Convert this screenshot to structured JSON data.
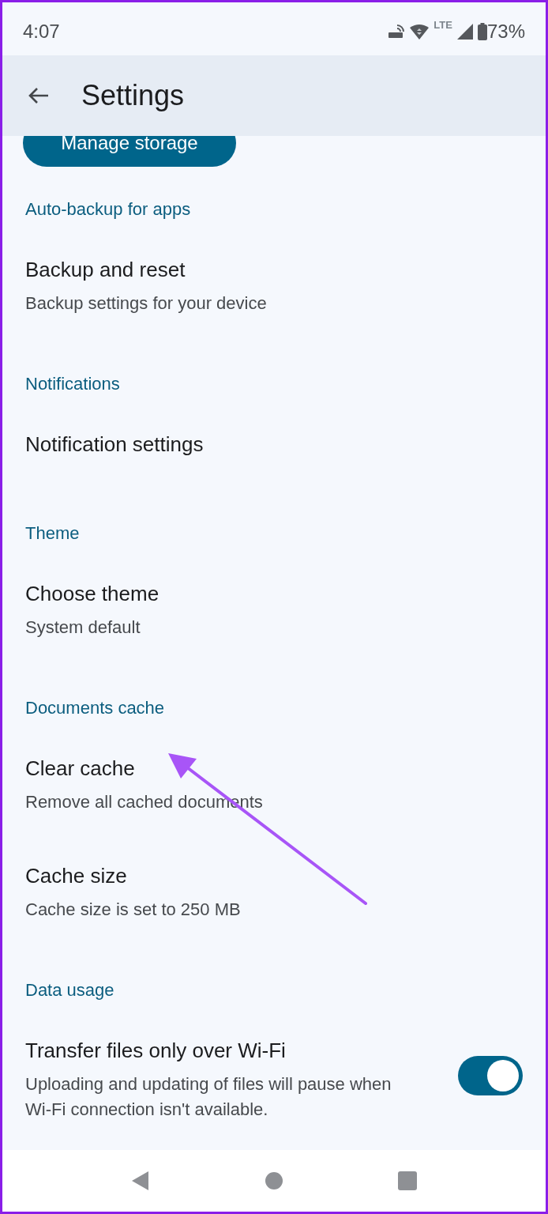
{
  "status_bar": {
    "time": "4:07",
    "network_label": "LTE",
    "battery": "73%"
  },
  "app_bar": {
    "title": "Settings"
  },
  "manage_storage_button": {
    "label": "Manage storage"
  },
  "sections": [
    {
      "header": "Auto-backup for apps",
      "items": [
        {
          "kind": "item",
          "title": "Backup and reset",
          "subtitle": "Backup settings for your device"
        }
      ]
    },
    {
      "header": "Notifications",
      "items": [
        {
          "kind": "item",
          "title": "Notification settings"
        }
      ]
    },
    {
      "header": "Theme",
      "items": [
        {
          "kind": "item",
          "title": "Choose theme",
          "subtitle": "System default"
        }
      ]
    },
    {
      "header": "Documents cache",
      "items": [
        {
          "kind": "item",
          "title": "Clear cache",
          "subtitle": "Remove all cached documents"
        },
        {
          "kind": "item",
          "title": "Cache size",
          "subtitle": "Cache size is set to 250 MB"
        }
      ]
    },
    {
      "header": "Data usage",
      "items": [
        {
          "kind": "toggle",
          "title": "Transfer files only over Wi-Fi",
          "subtitle": "Uploading and updating of files will pause when Wi-Fi connection isn't available.",
          "on": true
        }
      ]
    }
  ]
}
